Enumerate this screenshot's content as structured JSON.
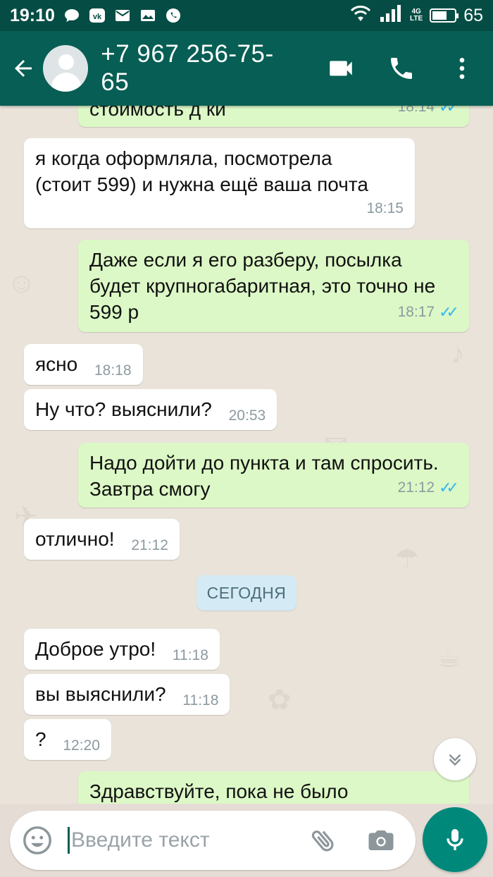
{
  "status_bar": {
    "time": "19:10",
    "network_type": "4G",
    "network_sub": "LTE",
    "battery": "65",
    "battery_level": 0.65,
    "notification_icons": [
      "message-icon",
      "vk-icon",
      "mail-icon",
      "gallery-icon",
      "whatsapp-icon"
    ]
  },
  "header": {
    "contact": "+7 967 256-75-65",
    "icons": [
      "back-arrow-icon",
      "avatar",
      "video-call-icon",
      "phone-icon",
      "more-vert-icon"
    ]
  },
  "chat": {
    "messages": [
      {
        "direction": "out",
        "text": "стоимость д           ки",
        "time": "18:14",
        "read": true
      },
      {
        "direction": "in",
        "text": "я когда оформляла, посмотрела (стоит 599) и нужна ещё ваша почта",
        "time": "18:15"
      },
      {
        "direction": "out",
        "text": "Даже если я его разберу, посылка будет крупногабаритная, это точно не 599 р",
        "time": "18:17",
        "read": true
      },
      {
        "direction": "in",
        "text": "ясно",
        "time": "18:18"
      },
      {
        "direction": "in",
        "text": "Ну что? выяснили?",
        "time": "20:53"
      },
      {
        "direction": "out",
        "text": "Надо дойти до пункта и там спросить. Завтра смогу",
        "time": "21:12",
        "read": true
      },
      {
        "direction": "in",
        "text": "отлично!",
        "time": "21:12"
      },
      {
        "direction": "in",
        "text": "Доброе утро!",
        "time": "11:18"
      },
      {
        "direction": "in",
        "text": "вы выяснили?",
        "time": "11:18"
      },
      {
        "direction": "in",
        "text": "?",
        "time": "12:20"
      },
      {
        "direction": "out",
        "text": "Здравствуйте, пока не было",
        "time": "",
        "read": false
      }
    ],
    "date_separator": "СЕГОДНЯ"
  },
  "input": {
    "placeholder": "Введите текст",
    "icons": [
      "emoji-icon",
      "attach-icon",
      "camera-icon",
      "mic-icon",
      "scroll-down-icon"
    ]
  },
  "colors": {
    "header": "#075e54",
    "status_bar": "#054d44",
    "outgoing_bubble": "#dcf8c6",
    "incoming_bubble": "#ffffff",
    "chat_background": "#e9e3da",
    "read_ticks": "#34b7f1",
    "mic_button": "#00897b",
    "date_chip": "#d4eaf4"
  }
}
